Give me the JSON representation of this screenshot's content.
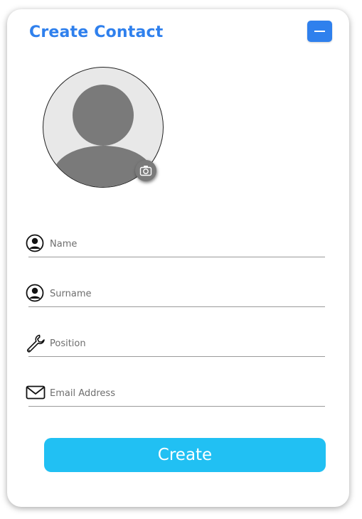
{
  "header": {
    "title": "Create Contact"
  },
  "colors": {
    "accent": "#2f80ed",
    "create_button": "#21c0f3",
    "avatar_bg": "#e8e8e8",
    "avatar_silhouette": "#7a7a7a"
  },
  "avatar": {
    "icon": "user-silhouette-icon",
    "camera_icon": "camera-icon"
  },
  "fields": {
    "name": {
      "placeholder": "Name",
      "value": "",
      "icon": "user-circle-icon"
    },
    "surname": {
      "placeholder": "Surname",
      "value": "",
      "icon": "user-circle-icon"
    },
    "position": {
      "placeholder": "Position",
      "value": "",
      "icon": "wrench-icon"
    },
    "email": {
      "placeholder": "Email Address",
      "value": "",
      "icon": "envelope-icon"
    }
  },
  "actions": {
    "create_label": "Create"
  }
}
